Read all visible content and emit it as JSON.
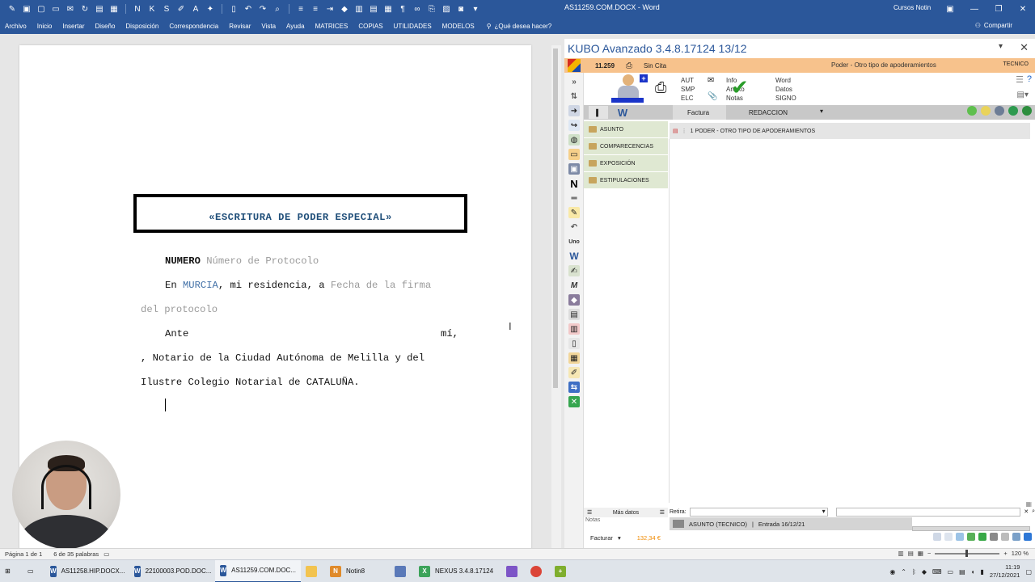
{
  "window": {
    "doc_title": "AS11259.COM.DOCX - Word",
    "user_name": "Cursos Notin"
  },
  "ribbon": {
    "tabs": [
      "Archivo",
      "Inicio",
      "Insertar",
      "Diseño",
      "Disposición",
      "Correspondencia",
      "Revisar",
      "Vista",
      "Ayuda",
      "MATRICES",
      "COPIAS",
      "UTILIDADES",
      "MODELOS"
    ],
    "tell_me": "¿Qué desea hacer?",
    "share": "Compartir"
  },
  "document": {
    "title": "«ESCRITURA DE PODER ESPECIAL»",
    "numero_label": "NUMERO",
    "numero_value": "Número de Protocolo",
    "line2_prefix": "En",
    "line2_city": "MURCIA",
    "line2_mid": ", mi residencia, a",
    "line2_date": "Fecha de la firma",
    "line3_date": "del protocolo",
    "line4_prefix": "Ante",
    "line4_suffix": "mí,",
    "line5": ", Notario de la Ciudad Autónoma de Melilla y del",
    "line6": "Ilustre Colegio Notarial de CATALUÑA."
  },
  "word_status": {
    "page": "Página 1 de 1",
    "words": "6 de 35 palabras",
    "zoom": "120 %"
  },
  "kubo": {
    "title": "KUBO Avanzado 3.4.8.17124   13/12",
    "number": "11.259",
    "cita": "Sin Cita",
    "tipo": "Poder - Otro tipo de apoderamientos",
    "usuario": "TECNICO",
    "aut_lines": [
      "AUT",
      "SMP",
      "ELC"
    ],
    "info_lines": [
      "Info",
      "Anexo",
      "Notas"
    ],
    "word_lines": [
      "Word",
      "Datos",
      "SIGNO"
    ],
    "sub_tabs": {
      "factura": "Factura",
      "redaccion": "REDACCION"
    },
    "sections": [
      "ASUNTO",
      "COMPARECENCIAS",
      "EXPOSICIÓN",
      "ESTIPULACIONES"
    ],
    "content_item": "1 PODER - OTRO TIPO DE APODERAMIENTOS",
    "mas_datos": "Más datos",
    "retira_label": "Retira:",
    "notas_label": "Notas",
    "asunto_status": "ASUNTO (TECNICO)",
    "entrada": "Entrada 16/12/21",
    "facturar": "Facturar",
    "amount": "132,34 €"
  },
  "taskbar": {
    "items": [
      {
        "label": "AS11258.HIP.DOCX...",
        "icon": "W"
      },
      {
        "label": "22100003.POD.DOC...",
        "icon": "W"
      },
      {
        "label": "AS11259.COM.DOC...",
        "icon": "W"
      },
      {
        "label": "Notin8",
        "icon": "N"
      },
      {
        "label": "NEXUS  3.4.8.17124",
        "icon": "X"
      }
    ],
    "time": "11:19",
    "date": "27/12/2021"
  },
  "colors": {
    "word_blue": "#2b579a",
    "kubo_orange": "#f7c28c",
    "section_green": "#dfe8d2",
    "amount_orange": "#f08a00"
  }
}
